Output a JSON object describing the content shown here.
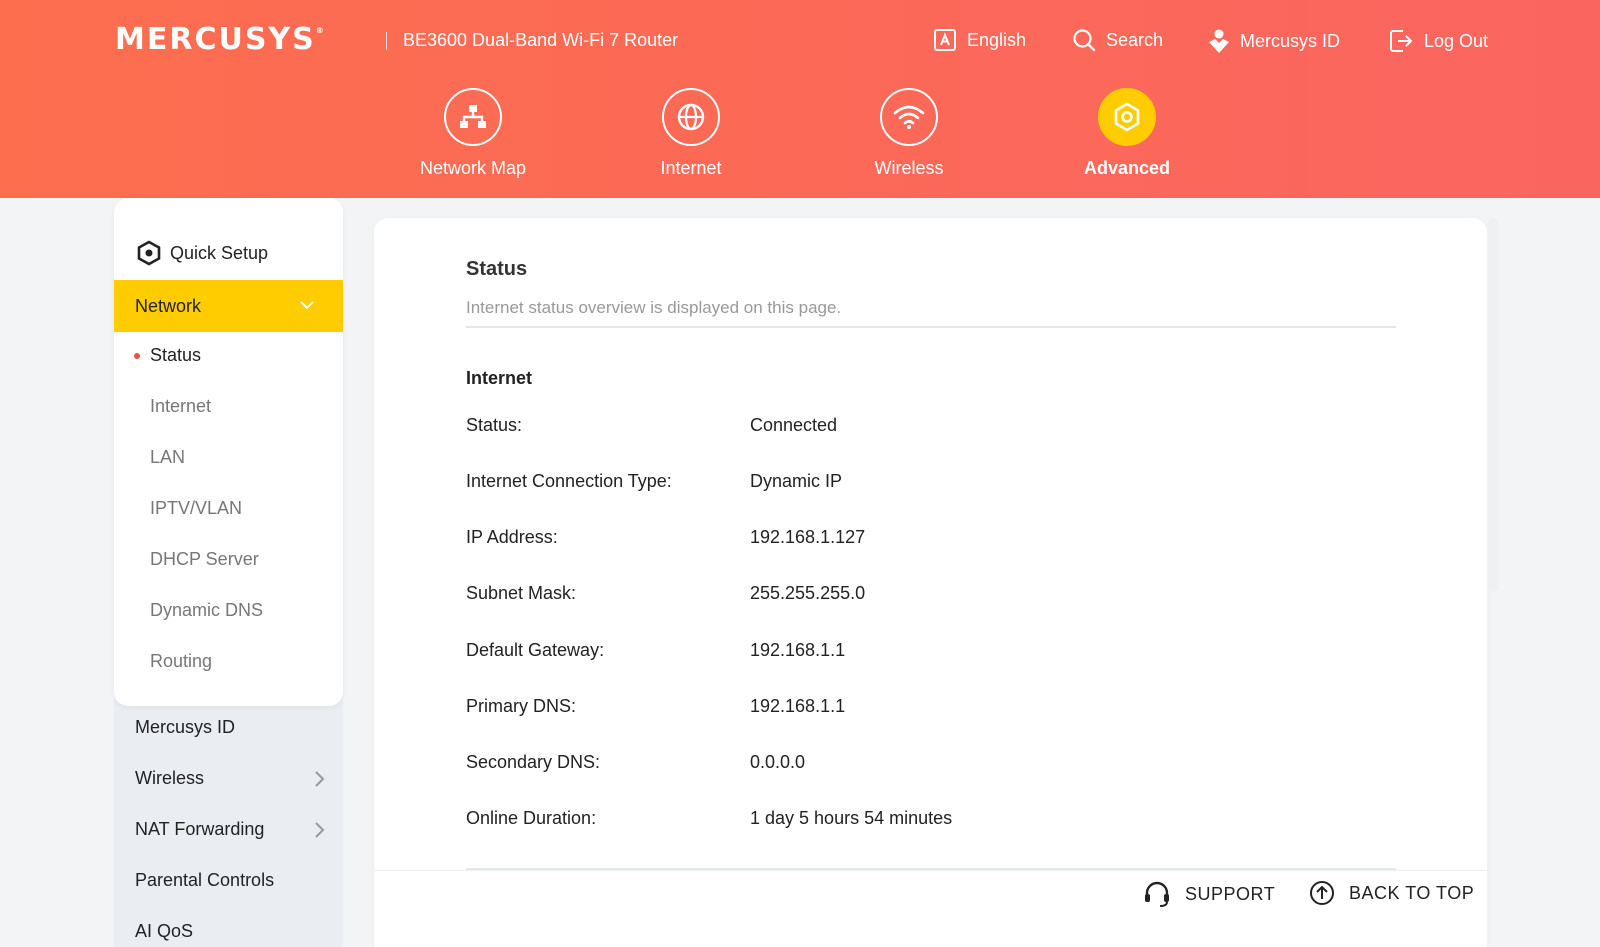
{
  "header": {
    "brand": "MERCUSYS",
    "product": "BE3600 Dual-Band Wi-Fi 7 Router",
    "links": {
      "language": "English",
      "search": "Search",
      "account": "Mercusys ID",
      "logout": "Log Out"
    },
    "nav": [
      {
        "label": "Network Map",
        "icon": "network-map-icon"
      },
      {
        "label": "Internet",
        "icon": "globe-icon"
      },
      {
        "label": "Wireless",
        "icon": "wifi-icon"
      },
      {
        "label": "Advanced",
        "icon": "gear-icon",
        "active": true
      }
    ]
  },
  "sidebar": {
    "quick_setup": "Quick Setup",
    "network": {
      "label": "Network",
      "items": [
        "Status",
        "Internet",
        "LAN",
        "IPTV/VLAN",
        "DHCP Server",
        "Dynamic DNS",
        "Routing"
      ],
      "active": "Status"
    },
    "items": [
      "Mercusys ID",
      "Wireless",
      "NAT Forwarding",
      "Parental Controls",
      "AI QoS"
    ]
  },
  "main": {
    "title": "Status",
    "description": "Internet status overview is displayed on this page.",
    "section": "Internet",
    "rows": [
      {
        "label": "Status:",
        "value": "Connected"
      },
      {
        "label": "Internet Connection Type:",
        "value": "Dynamic IP"
      },
      {
        "label": "IP Address:",
        "value": "192.168.1.127"
      },
      {
        "label": "Subnet Mask:",
        "value": "255.255.255.0"
      },
      {
        "label": "Default Gateway:",
        "value": "192.168.1.1"
      },
      {
        "label": "Primary DNS:",
        "value": "192.168.1.1"
      },
      {
        "label": "Secondary DNS:",
        "value": "0.0.0.0"
      },
      {
        "label": "Online Duration:",
        "value": "1 day 5 hours 54 minutes"
      }
    ]
  },
  "footer": {
    "support": "SUPPORT",
    "back_to_top": "BACK TO TOP"
  },
  "colors": {
    "header": "#fc6a55",
    "accent": "#ffcc00",
    "active_dot": "#e9513d"
  }
}
